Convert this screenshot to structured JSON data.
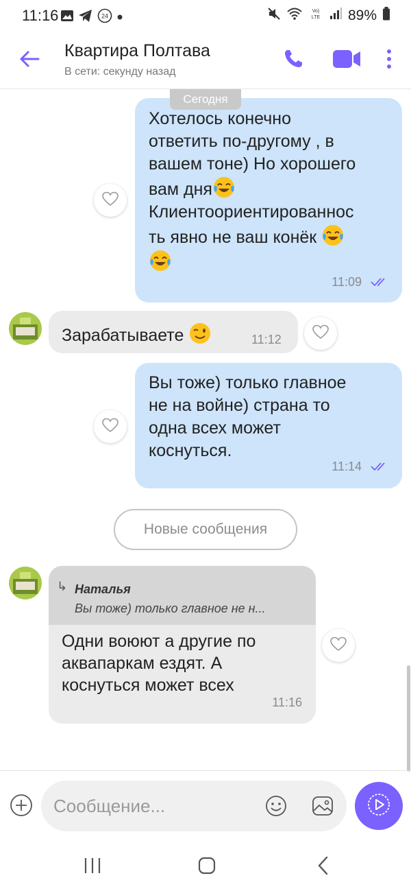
{
  "status_bar": {
    "time": "11:16",
    "battery": "89%"
  },
  "header": {
    "title": "Квартира Полтава",
    "subtitle": "В сети: секунду назад"
  },
  "date_badge": "Сегодня",
  "messages": [
    {
      "direction": "outgoing",
      "lines": [
        "Хотелось конечно",
        "ответить по-другому , в",
        "вашем тоне) Но хорошего",
        "вам дня",
        "Клиентоориентированнос",
        "ть явно не ваш конёк"
      ],
      "time": "11:09"
    },
    {
      "direction": "incoming",
      "text": "Зарабатываете",
      "time": "11:12"
    },
    {
      "direction": "outgoing",
      "lines": [
        "Вы тоже) только главное",
        "не на войне) страна то",
        "одна всех может",
        "коснуться."
      ],
      "time": "11:14"
    },
    {
      "direction": "incoming",
      "reply_to": {
        "name": "Наталья",
        "text": "Вы тоже) только главное не н..."
      },
      "lines": [
        "Одни воюют а другие по",
        "аквапаркам ездят. А",
        "коснуться может всех"
      ],
      "time": "11:16"
    }
  ],
  "new_messages_label": "Новые сообщения",
  "composer": {
    "placeholder": "Сообщение..."
  },
  "colors": {
    "accent": "#7b61ff",
    "outgoing_bubble": "#cde4fb",
    "incoming_bubble": "#ebebeb"
  }
}
